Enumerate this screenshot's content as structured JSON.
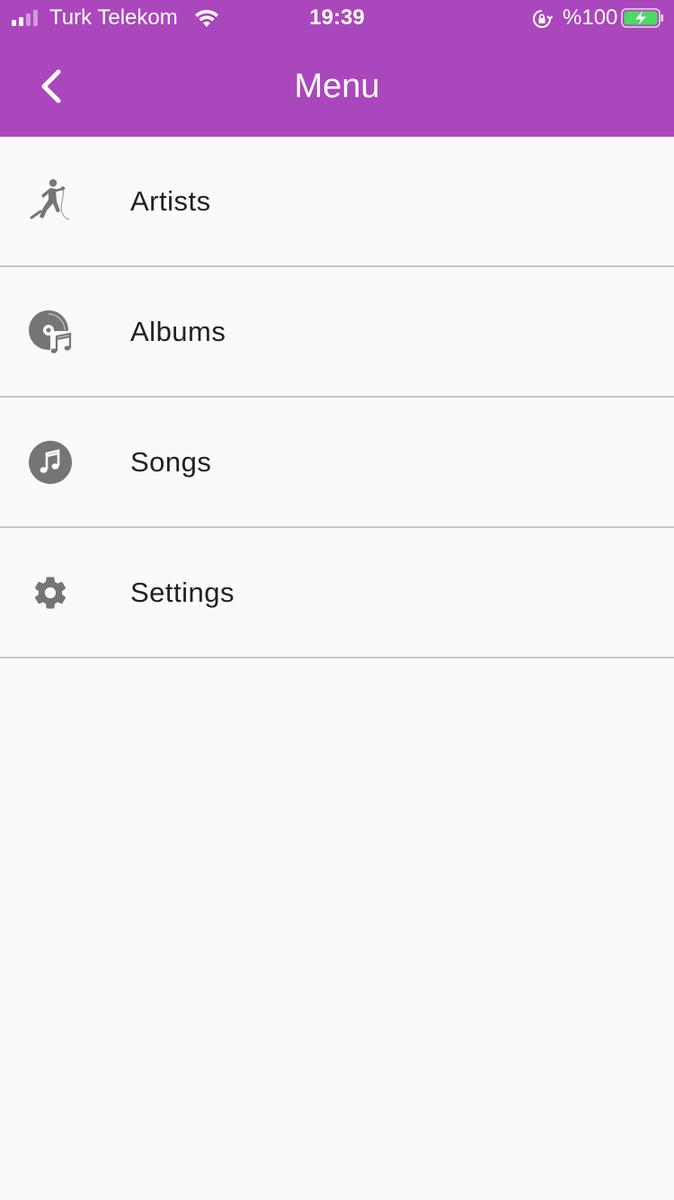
{
  "status_bar": {
    "carrier": "Turk Telekom",
    "time": "19:39",
    "battery_percent": "%100",
    "signal_bars_filled": 2,
    "signal_bars_total": 4,
    "charging": true
  },
  "header": {
    "title": "Menu",
    "background_color": "#ab47bc"
  },
  "menu": {
    "items": [
      {
        "label": "Artists",
        "icon": "singer-icon"
      },
      {
        "label": "Albums",
        "icon": "album-music-icon"
      },
      {
        "label": "Songs",
        "icon": "music-note-icon"
      },
      {
        "label": "Settings",
        "icon": "gear-icon"
      }
    ]
  },
  "colors": {
    "icon": "#757575",
    "text": "#212121",
    "divider": "#c7c7c7",
    "background": "#fafafa",
    "battery_fill": "#4cd964"
  }
}
